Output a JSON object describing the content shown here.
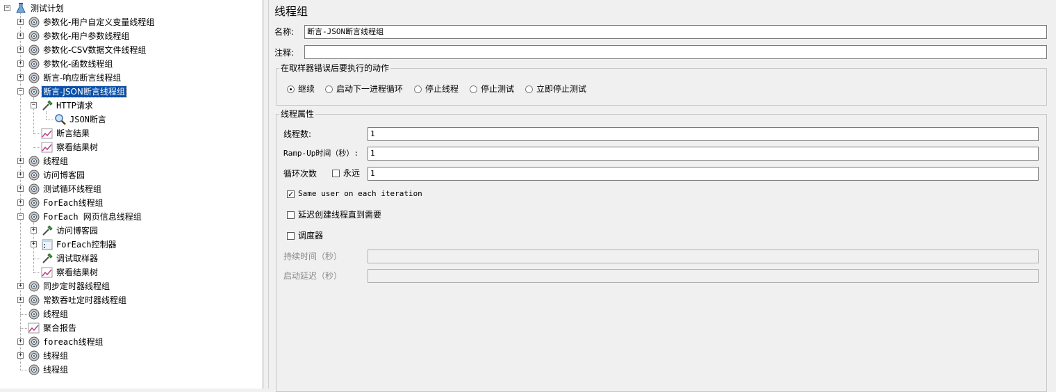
{
  "tree": {
    "items": [
      {
        "label": "测试计划",
        "icon": "test-plan-icon",
        "expanded": true
      },
      {
        "label": "参数化-用户自定义变量线程组",
        "icon": "gear-icon",
        "expanded": false
      },
      {
        "label": "参数化-用户参数线程组",
        "icon": "gear-icon",
        "expanded": false
      },
      {
        "label": "参数化-CSV数据文件线程组",
        "icon": "gear-icon",
        "expanded": false
      },
      {
        "label": "参数化-函数线程组",
        "icon": "gear-icon",
        "expanded": false
      },
      {
        "label": "断言-响应断言线程组",
        "icon": "gear-icon",
        "expanded": false
      },
      {
        "label": "断言-JSON断言线程组",
        "icon": "gear-icon",
        "expanded": true,
        "selected": true
      },
      {
        "label": "HTTP请求",
        "icon": "pipette-icon",
        "expanded": true
      },
      {
        "label": "JSON断言",
        "icon": "magnifier-icon"
      },
      {
        "label": "断言结果",
        "icon": "graph-icon"
      },
      {
        "label": "察看结果树",
        "icon": "graph-icon"
      },
      {
        "label": "线程组",
        "icon": "gear-icon",
        "expanded": false
      },
      {
        "label": "访问博客园",
        "icon": "gear-icon",
        "expanded": false
      },
      {
        "label": "测试循环线程组",
        "icon": "gear-icon",
        "expanded": false
      },
      {
        "label": "ForEach线程组",
        "icon": "gear-icon",
        "expanded": false
      },
      {
        "label": "ForEach 网页信息线程组",
        "icon": "gear-icon",
        "expanded": true
      },
      {
        "label": "访问博客园",
        "icon": "pipette-icon",
        "expanded": false
      },
      {
        "label": "ForEach控制器",
        "icon": "controller-icon",
        "expanded": false
      },
      {
        "label": "调试取样器",
        "icon": "pipette-icon"
      },
      {
        "label": "察看结果树",
        "icon": "graph-icon"
      },
      {
        "label": "同步定时器线程组",
        "icon": "gear-icon",
        "expanded": false
      },
      {
        "label": "常数吞吐定时器线程组",
        "icon": "gear-icon",
        "expanded": false
      },
      {
        "label": "线程组",
        "icon": "gear-icon"
      },
      {
        "label": "聚合报告",
        "icon": "graph-icon"
      },
      {
        "label": "foreach线程组",
        "icon": "gear-icon",
        "expanded": false
      },
      {
        "label": "线程组",
        "icon": "gear-icon",
        "expanded": false
      },
      {
        "label": "线程组",
        "icon": "gear-icon"
      }
    ]
  },
  "panel": {
    "title": "线程组",
    "name_label": "名称:",
    "name_value": "断言-JSON断言线程组",
    "comment_label": "注释:",
    "comment_value": "",
    "error_group": {
      "title": "在取样器错误后要执行的动作",
      "options": [
        "继续",
        "启动下一进程循环",
        "停止线程",
        "停止测试",
        "立即停止测试"
      ],
      "selected": "继续"
    },
    "props_group": {
      "title": "线程属性",
      "threads_label": "线程数:",
      "threads_value": "1",
      "rampup_label": "Ramp-Up时间（秒）:",
      "rampup_value": "1",
      "loop_label": "循环次数",
      "forever_label": "永远",
      "forever_checked": false,
      "loop_value": "1",
      "same_user_label": "Same user on each iteration",
      "same_user_checked": true,
      "delay_label": "延迟创建线程直到需要",
      "delay_checked": false,
      "scheduler_label": "调度器",
      "scheduler_checked": false,
      "duration_label": "持续时间（秒）",
      "duration_value": "",
      "startup_delay_label": "启动延迟（秒）",
      "startup_delay_value": ""
    }
  },
  "colors": {
    "selection": "#0a4fa8",
    "panel_bg": "#f0f0f0",
    "tree_bg": "#ffffff"
  }
}
